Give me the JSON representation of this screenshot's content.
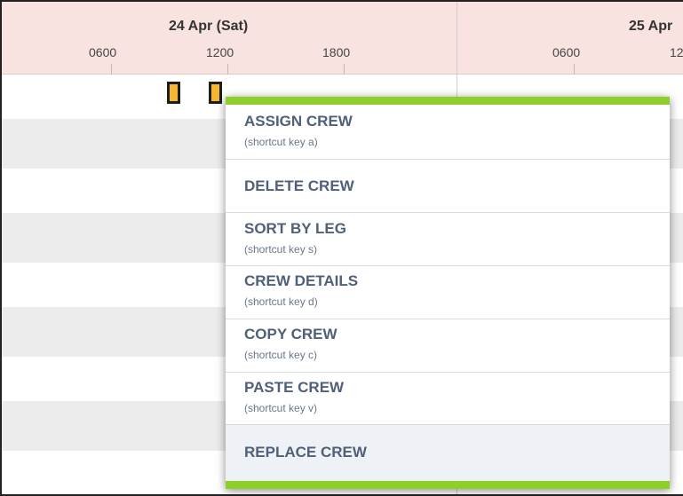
{
  "timeline": {
    "days": [
      {
        "label": "24 Apr (Sat)",
        "hours": [
          "0600",
          "1200",
          "1800"
        ]
      },
      {
        "label": "25 Apr",
        "hours": [
          "0600",
          "12"
        ]
      }
    ]
  },
  "colors": {
    "header_bg": "#f9e3e1",
    "row_alt": "#ececec",
    "crew_block": "#f5b731",
    "menu_accent": "#8fcf2c",
    "menu_text": "#4f6078"
  },
  "context_menu": {
    "items": [
      {
        "label": "ASSIGN CREW",
        "hint": "(shortcut key a)"
      },
      {
        "label": "DELETE CREW",
        "hint": ""
      },
      {
        "label": "SORT BY LEG",
        "hint": "(shortcut key s)"
      },
      {
        "label": "CREW DETAILS",
        "hint": "(shortcut key d)"
      },
      {
        "label": "COPY CREW",
        "hint": "(shortcut key c)"
      },
      {
        "label": "PASTE CREW",
        "hint": "(shortcut key v)"
      },
      {
        "label": "REPLACE CREW",
        "hint": ""
      }
    ]
  }
}
